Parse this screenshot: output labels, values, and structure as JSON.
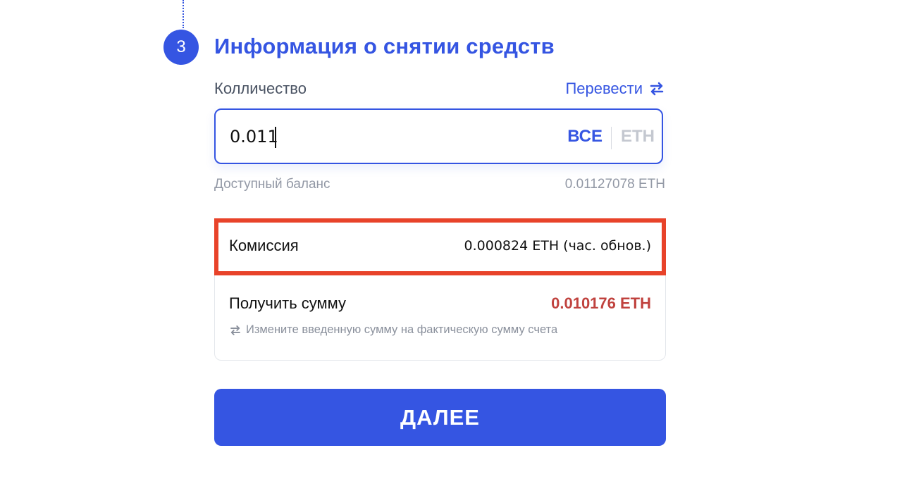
{
  "step": {
    "number": "3",
    "title": "Информация о снятии средств"
  },
  "quantity": {
    "label": "Колличество",
    "convert_label": "Перевести",
    "convert_icon": "swap-arrows-icon",
    "input_value": "0.011",
    "all_label": "ВСЕ",
    "unit": "ETH"
  },
  "balance": {
    "label": "Доступный баланс",
    "value": "0.01127078 ETH"
  },
  "summary": {
    "fee_label": "Комиссия",
    "fee_value": "0.000824 ETH (час. обнов.)",
    "receive_label": "Получить сумму",
    "receive_value": "0.010176 ETH",
    "hint_icon": "swap-arrows-icon",
    "hint_text": "Измените введенную сумму на фактическую сумму счета"
  },
  "next_button": {
    "label": "ДАЛЕЕ"
  },
  "colors": {
    "accent": "#3555e2",
    "highlight": "#e8432a",
    "receive": "#c0423e"
  }
}
